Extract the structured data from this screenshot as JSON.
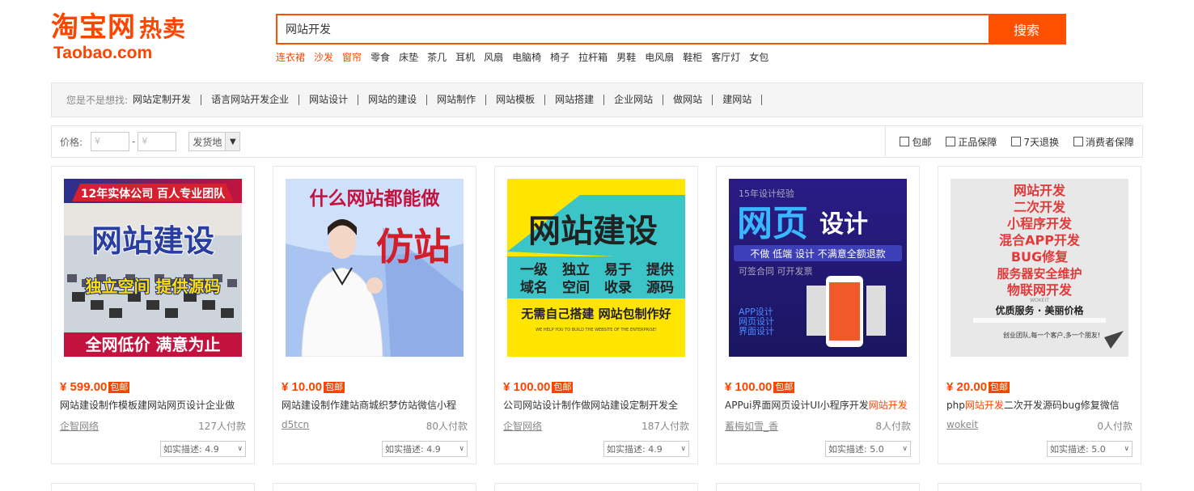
{
  "logo": {
    "cn_main": "淘宝网",
    "cn_sub": "热卖",
    "en": "Taobao.com"
  },
  "search": {
    "value": "网站开发",
    "button": "搜索"
  },
  "hot_keywords": [
    {
      "text": "连衣裙",
      "red": true
    },
    {
      "text": "沙发",
      "red": true
    },
    {
      "text": "窗帘",
      "red": true
    },
    {
      "text": "零食",
      "red": false
    },
    {
      "text": "床垫",
      "red": false
    },
    {
      "text": "茶几",
      "red": false
    },
    {
      "text": "耳机",
      "red": false
    },
    {
      "text": "风扇",
      "red": false
    },
    {
      "text": "电脑椅",
      "red": false
    },
    {
      "text": "椅子",
      "red": false
    },
    {
      "text": "拉杆箱",
      "red": false
    },
    {
      "text": "男鞋",
      "red": false
    },
    {
      "text": "电风扇",
      "red": false
    },
    {
      "text": "鞋柜",
      "red": false
    },
    {
      "text": "客厅灯",
      "red": false
    },
    {
      "text": "女包",
      "red": false
    }
  ],
  "suggest": {
    "label": "您是不是想找:",
    "items": [
      "网站定制开发",
      "语言网站开发企业",
      "网站设计",
      "网站的建设",
      "网站制作",
      "网站模板",
      "网站搭建",
      "企业网站",
      "做网站",
      "建网站"
    ]
  },
  "filter": {
    "price_label": "价格:",
    "price_min_placeholder": "¥",
    "price_max_placeholder": "¥",
    "dash": "-",
    "ship_from": "发货地",
    "checks": [
      "包邮",
      "正品保障",
      "7天退换",
      "消费者保障"
    ]
  },
  "products": [
    {
      "price": "¥ 599.00",
      "badge": "包邮",
      "title": "网站建设制作模板建网站网页设计企业做",
      "title_hl": "",
      "title_tail": "",
      "shop": "企智网络",
      "paid": "127人付款",
      "rating": "如实描述: 4.9",
      "img": {
        "top": "12年实体公司 百人专业团队",
        "big": "网站建设",
        "mid": "独立空间 提供源码",
        "bottom": "全网低价 满意为止"
      }
    },
    {
      "price": "¥ 10.00",
      "badge": "包邮",
      "title": "网站建设制作建站商城织梦仿站微信小程",
      "title_hl": "",
      "title_tail": "",
      "shop": "d5tcn",
      "paid": "80人付款",
      "rating": "如实描述: 4.9",
      "img": {
        "top": "什么网站都能做",
        "big": "仿站"
      }
    },
    {
      "price": "¥ 100.00",
      "badge": "包邮",
      "title": "公司网站设计制作做网站建设定制开发全",
      "title_hl": "",
      "title_tail": "",
      "shop": "企智网络",
      "paid": "187人付款",
      "rating": "如实描述: 4.9",
      "img": {
        "big": "网站建设",
        "grid1": [
          "一级",
          "独立",
          "易于",
          "提供"
        ],
        "grid2": [
          "域名",
          "空间",
          "收录",
          "源码"
        ],
        "slogan": "无需自己搭建 网站包制作好",
        "small": "WE HELP YOU TO BUILD THE WEBSITE OF THE ENTERPRISE!"
      }
    },
    {
      "price": "¥ 100.00",
      "badge": "包邮",
      "title": "APPui界面网页设计UI小程序开发",
      "title_hl": "网站开发",
      "title_tail": "",
      "shop": "蓄梅如雪_香",
      "paid": "8人付款",
      "rating": "如实描述: 5.0",
      "img": {
        "top": "15年设计经验",
        "big1": "网页",
        "big2": "设计",
        "bar": "不做 低端 设计 不满意全额退款",
        "sub": "可签合同 可开发票",
        "list": [
          "APP设计",
          "网页设计",
          "界面设计"
        ]
      }
    },
    {
      "price": "¥ 20.00",
      "badge": "包邮",
      "title": "php",
      "title_hl": "网站开发",
      "title_tail": "二次开发源码bug修复微信",
      "shop": "wokeit",
      "paid": "0人付款",
      "rating": "如实描述: 5.0",
      "img": {
        "lines": [
          "网站开发",
          "二次开发",
          "小程序开发",
          "混合APP开发",
          "BUG修复",
          "服务器安全维护",
          "物联网开发"
        ],
        "brand": "WOKEIT",
        "motto": "优质服务 · 美丽价格",
        "team": "创业团队,每一个客户,多一个朋友!"
      }
    }
  ],
  "colors": {
    "accent": "#ff4400",
    "search_border": "#ff5000"
  }
}
